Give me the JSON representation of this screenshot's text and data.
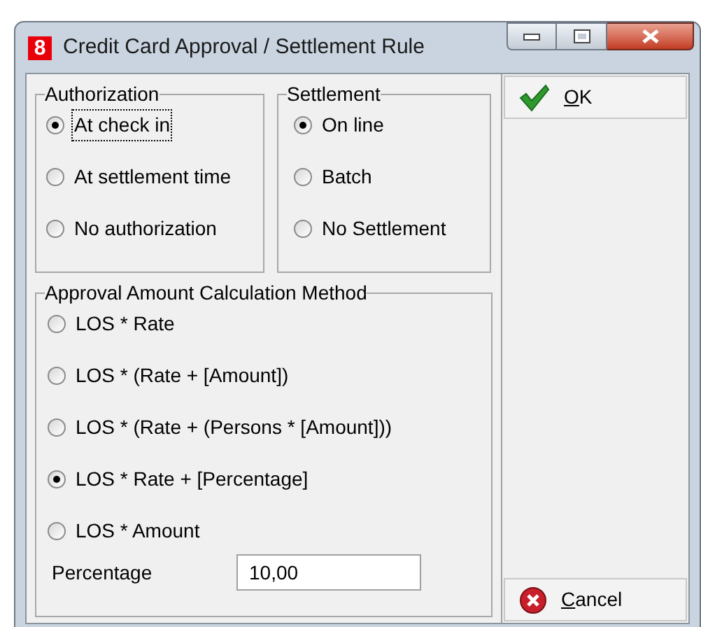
{
  "window": {
    "icon": "8",
    "title": "Credit Card Approval / Settlement Rule"
  },
  "authorization": {
    "title": "Authorization",
    "options": [
      {
        "label": "At check in",
        "selected": true,
        "focused": true
      },
      {
        "label": "At settlement time",
        "selected": false,
        "focused": false
      },
      {
        "label": "No authorization",
        "selected": false,
        "focused": false
      }
    ]
  },
  "settlement": {
    "title": "Settlement",
    "options": [
      {
        "label": "On line",
        "selected": true,
        "focused": false
      },
      {
        "label": "Batch",
        "selected": false,
        "focused": false
      },
      {
        "label": "No Settlement",
        "selected": false,
        "focused": false
      }
    ]
  },
  "calculation": {
    "title": "Approval Amount Calculation Method",
    "options": [
      {
        "label": "LOS * Rate",
        "selected": false,
        "focused": false
      },
      {
        "label": "LOS * (Rate + [Amount])",
        "selected": false,
        "focused": false
      },
      {
        "label": "LOS * (Rate + (Persons * [Amount]))",
        "selected": false,
        "focused": false
      },
      {
        "label": "LOS * Rate + [Percentage]",
        "selected": true,
        "focused": false
      },
      {
        "label": "LOS * Amount",
        "selected": false,
        "focused": false
      }
    ],
    "percentage": {
      "label": "Percentage",
      "value": "10,00"
    }
  },
  "buttons": [
    {
      "kind": "ok",
      "label": "OK"
    },
    {
      "kind": "cancel",
      "label": "Cancel"
    }
  ]
}
